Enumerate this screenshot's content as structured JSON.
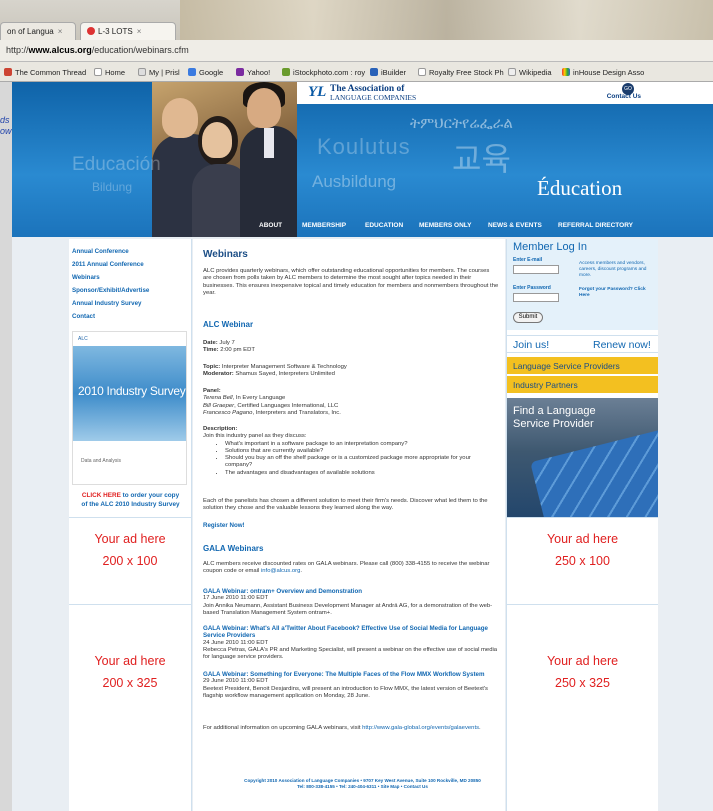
{
  "browser": {
    "tabs": [
      "on of Langua",
      "L-3 LOTS"
    ],
    "url_prefix": "http://",
    "url_host": "www.alcus.org",
    "url_path": "/education/webinars.cfm",
    "bookmarks": [
      "The Common Thread",
      "Home",
      "My | Prisl",
      "Google",
      "Yahoo!",
      "iStockphoto.com : roy",
      "iBuilder",
      "Royalty Free Stock Ph",
      "Wikipedia",
      "inHouse Design Asso"
    ]
  },
  "underlying_window": {
    "fragments": [
      "ds",
      "ow"
    ]
  },
  "header": {
    "logo_mark": "YL",
    "logo_line1": "The Association of",
    "logo_line2": "LANGUAGE COMPANIES",
    "contact_label": "Contact Us",
    "go_label": "GO",
    "watermarks": [
      "Educación",
      "Bildung",
      "Koulutus",
      "Ausbildung",
      "ትምህርትየሬፌራል",
      "교육"
    ],
    "tagline": "Éducation",
    "nav": [
      "ABOUT",
      "MEMBERSHIP",
      "EDUCATION",
      "MEMBERS ONLY",
      "NEWS & EVENTS",
      "REFERRAL DIRECTORY"
    ]
  },
  "left": {
    "links": [
      "Annual Conference",
      "2011 Annual Conference",
      "Webinars",
      "Sponsor/Exhibit/Advertise",
      "Annual Industry Survey",
      "Contact"
    ],
    "survey_brand": "ALC",
    "survey_title": "2010 Industry Survey",
    "survey_sub": "Data and Analysis",
    "cta_red": "CLICK HERE",
    "cta_rest1": " to order your copy",
    "cta_rest2": "of the ALC 2010 Industry Survey",
    "ad1": [
      "Your ad here",
      "200 x 100"
    ],
    "ad2": [
      "Your ad here",
      "200 x 325"
    ]
  },
  "main": {
    "title": "Webinars",
    "intro": "ALC provides quarterly webinars, which offer outstanding educational opportunities for members. The courses are chosen from polls taken by ALC members to determine the most sought after topics needed in their businesses. This ensures inexpensive topical and timely education for members and nonmembers throughout the year.",
    "alc_heading": "ALC Webinar",
    "date_label": "Date:",
    "date": " July 7",
    "time_label": "Time:",
    "time": " 2:00 pm EDT",
    "topic_label": "Topic:",
    "topic": " Interpreter Management Software & Technology",
    "moderator_label": "Moderator:",
    "moderator": " Shamus Sayed, Interpreters Unlimited",
    "panel_label": "Panel:",
    "panel": [
      {
        "name": "Terena Bell",
        "org": ", In Every Language"
      },
      {
        "name": "Bill Graeper",
        "org": ", Certified Languages International, LLC"
      },
      {
        "name": "Francesco Pagano",
        "org": ", Interpreters and Translators, Inc."
      }
    ],
    "description_label": "Description:",
    "description_intro": "Join this industry panel as they discuss:",
    "bullets": [
      "What's important in a software package to an interpretation company?",
      "Solutions that are currently available?",
      "Should you buy an off the shelf package or is a customized package more appropriate for your company?",
      "The advantages and disadvantages of available solutions"
    ],
    "closing": "Each of the panelists has chosen a different solution to meet their firm's needs. Discover what led them to the solution they chose and the valuable lessons they learned along the way.",
    "register": "Register Now!",
    "gala_heading": "GALA Webinars",
    "gala_intro_a": "ALC members receive discounted rates on GALA webinars. Please call (800) 338-4155 to receive the webinar coupon code or email ",
    "gala_email": "info@alcus.org",
    "gala_intro_b": ".",
    "gala_items": [
      {
        "title": "GALA Webinar: ontram+ Overview and Demonstration",
        "date": "17 June 2010 11:00 EDT",
        "body": "Join Annika Neumann, Assistant Business Development Manager at Andrä AG, for a demonstration of the web-based Translation Management System ontram+."
      },
      {
        "title": "GALA Webinar: What's All a'Twitter About Facebook? Effective Use of Social Media for Language Service Providers",
        "date": "24 June 2010 11:00 EDT",
        "body": "Rebecca Petras, GALA's PR and Marketing Specialist, will present a webinar on the effective use of social media for language service providers."
      },
      {
        "title": "GALA Webinar: Something for Everyone: The Multiple Faces of the Flow MMX Workflow System",
        "date": "29 June 2010 11:00 EDT",
        "body": "Beetext President, Benoit Desjardins, will present an introduction to Flow MMX, the latest version of Beetext's flagship workflow management application on Monday, 28 June."
      }
    ],
    "more_a": "For additional information on upcoming GALA webinars, visit ",
    "more_link": "http://www.gala-global.org/events/galaevents",
    "more_b": "."
  },
  "right": {
    "login_title": "Member Log In",
    "email_label": "Enter E-mail",
    "password_label": "Enter Password",
    "side_text": "Access members and vendors, careers, discount programs and more.",
    "forgot": "Forgot your Password? Click Here",
    "submit": "Submit",
    "join": "Join us!",
    "renew": "Renew now!",
    "btn1": "Language Service Providers",
    "btn2": "Industry Partners",
    "finder": "Find a Language Service Provider",
    "ad1": [
      "Your ad here",
      "250 x 100"
    ],
    "ad2": [
      "Your ad here",
      "250 x 325"
    ]
  },
  "footer": {
    "line1": "Copyright 2010 Association of Language Companies  •  9707 Key West Avenue, Suite 100 Rockville, MD 20850",
    "line2": "Tel: 800-338-4155  •  Tel: 240-404-6311  •  Site Map  •  Contact Us"
  }
}
